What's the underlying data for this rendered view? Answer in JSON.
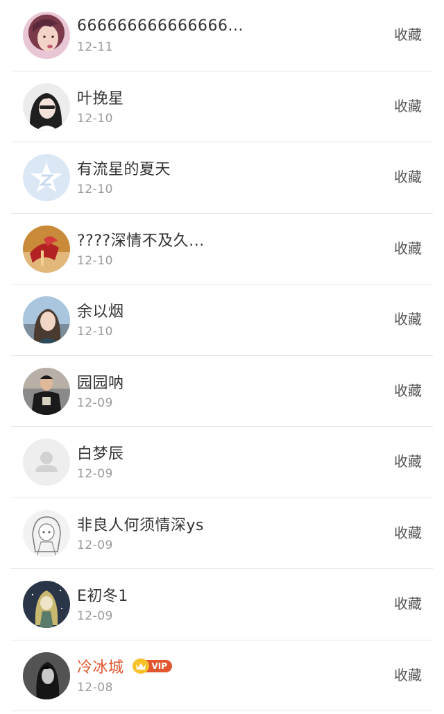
{
  "users": [
    {
      "name": "666666666666666...",
      "date": "12-11",
      "action": "收藏",
      "avatar": "avatar-photo-girl-pink",
      "colors": [
        "#caa0b8",
        "#7a3a4a"
      ]
    },
    {
      "name": "叶挽星",
      "date": "12-10",
      "action": "收藏",
      "avatar": "avatar-photo-girl-dark-hair",
      "colors": [
        "#e8e8e8",
        "#222222"
      ]
    },
    {
      "name": "有流星的夏天",
      "date": "12-10",
      "action": "收藏",
      "avatar": "avatar-default-star-logo",
      "colors": [
        "#dbe6f5",
        "#ffffff"
      ]
    },
    {
      "name": "????深情不及久...",
      "date": "12-10",
      "action": "收藏",
      "avatar": "avatar-photo-red-gift",
      "colors": [
        "#c98a3a",
        "#b22222"
      ]
    },
    {
      "name": "余以烟",
      "date": "12-10",
      "action": "收藏",
      "avatar": "avatar-photo-girl-outdoor",
      "colors": [
        "#a6c4dc",
        "#4a3a30"
      ]
    },
    {
      "name": "园园呐",
      "date": "12-09",
      "action": "收藏",
      "avatar": "avatar-photo-boy-black-shirt",
      "colors": [
        "#8a8a8a",
        "#1a1a1a"
      ]
    },
    {
      "name": "白梦辰",
      "date": "12-09",
      "action": "收藏",
      "avatar": "avatar-default-person",
      "colors": [
        "#ededed",
        "#d0d0d0"
      ]
    },
    {
      "name": "非良人何须情深ys",
      "date": "12-09",
      "action": "收藏",
      "avatar": "avatar-sketch-anime-girl",
      "colors": [
        "#f2f2f2",
        "#666666"
      ]
    },
    {
      "name": "E初冬1",
      "date": "12-09",
      "action": "收藏",
      "avatar": "avatar-anime-dark-blue",
      "colors": [
        "#2a3548",
        "#c8b870"
      ]
    },
    {
      "name": "冷冰城",
      "date": "12-08",
      "action": "收藏",
      "avatar": "avatar-photo-girl-dark",
      "colors": [
        "#3a3a3a",
        "#b0b0b0"
      ],
      "vip": true,
      "vip_label": "VIP",
      "name_color": "#e1562e"
    }
  ]
}
